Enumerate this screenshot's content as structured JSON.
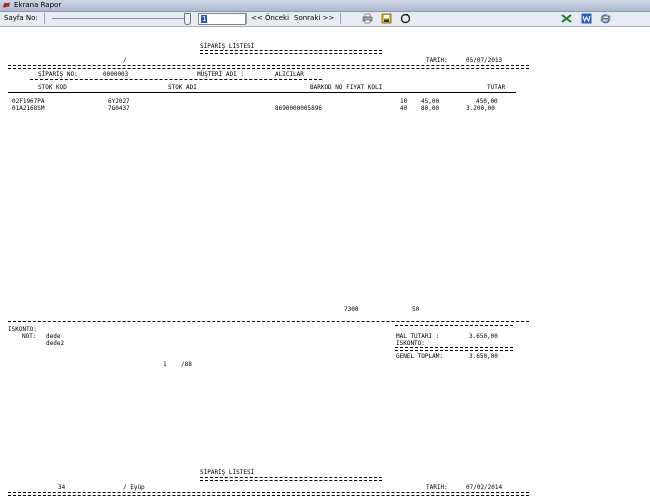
{
  "window": {
    "title": "Ekrana Rapor"
  },
  "toolbar": {
    "page_label": "Sayfa No:",
    "page_value": "1",
    "prev_label": "<< Önceki",
    "next_label": "Sonraki >>",
    "icons": [
      "printer-icon",
      "save-icon",
      "refresh-icon",
      "excel-icon",
      "word-icon",
      "ie-icon"
    ]
  },
  "report": {
    "title": "SİPARİŞ LİSTESİ",
    "top_left_mark": "/",
    "date_label": "TARIH:",
    "date_value": "05/07/2013",
    "order_no_label": "ŞİPARİŞ NO:",
    "order_no": "0000003",
    "customer_label": "MÜŞTERİ ADI :",
    "customer": "ALICILAR",
    "columns": {
      "stok_kod": "STOK KOD",
      "stok_adi": "STOK ADI",
      "barkod": "BARKOD NO FIYAT KOLI",
      "tutar": "TUTAR"
    },
    "rows": [
      {
        "code": "02F1967PA",
        "name": "6Y2027",
        "barcode": "",
        "koli": "10",
        "price": "45,00",
        "total": "450,00"
      },
      {
        "code": "01A2168SM",
        "name": "7G0437",
        "barcode": "8690000005896",
        "koli": "40",
        "price": "80,00",
        "total": "3.200,00"
      }
    ],
    "sum_a": "7300",
    "sum_b": "50",
    "iskonto_label": "ISKONTO:",
    "not_label": "NOT:",
    "not_line1": "dede",
    "not_line2": "dede2",
    "page_info": "1    /88",
    "mal_tutari_label": "MAL TUTARI :",
    "mal_tutari": "3.650,00",
    "iskonto2_label": "ISKONTO:",
    "genel_label": "GENEL TOPLAM:",
    "genel_toplam": "3.650,00",
    "second": {
      "title": "SİPARİŞ LİSTESİ",
      "left_num": "34",
      "left_text": "/ Eyüp",
      "date_label": "TARIH:",
      "date_value": "07/02/2014"
    }
  }
}
